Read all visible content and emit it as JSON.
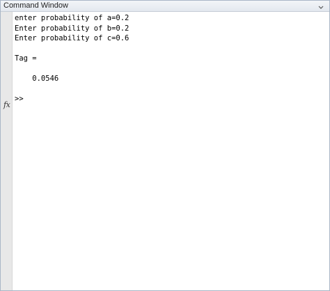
{
  "window": {
    "title": "Command Window"
  },
  "console": {
    "lines": [
      "enter probability of a=0.2",
      "Enter probability of b=0.2",
      "Enter probability of c=0.6",
      "",
      "Tag =",
      "",
      "    0.0546",
      "",
      ">>"
    ]
  },
  "gutter": {
    "fx_icon_label": "fx"
  },
  "icons": {
    "title_menu": "chevron-down-icon",
    "function_browser": "fx-icon"
  }
}
